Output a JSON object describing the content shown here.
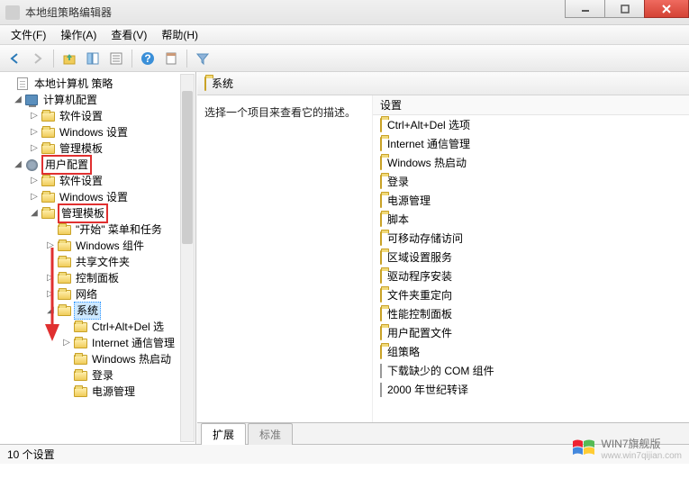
{
  "title": "本地组策略编辑器",
  "menu": {
    "file": "文件(F)",
    "action": "操作(A)",
    "view": "查看(V)",
    "help": "帮助(H)"
  },
  "tree": {
    "root": "本地计算机 策略",
    "computer_config": "计算机配置",
    "cc_software": "软件设置",
    "cc_windows": "Windows 设置",
    "cc_admin": "管理模板",
    "user_config": "用户配置",
    "uc_software": "软件设置",
    "uc_windows": "Windows 设置",
    "uc_admin": "管理模板",
    "uc_start_taskbar": "\"开始\" 菜单和任务",
    "uc_win_components": "Windows 组件",
    "uc_shared_folders": "共享文件夹",
    "uc_control_panel": "控制面板",
    "uc_network": "网络",
    "uc_system": "系统",
    "sys_ctrlaltdel": "Ctrl+Alt+Del 选",
    "sys_internet": "Internet 通信管理",
    "sys_win_hot": "Windows 热启动",
    "sys_logon": "登录",
    "sys_power": "电源管理"
  },
  "content": {
    "heading": "系统",
    "description": "选择一个项目来查看它的描述。",
    "settings_header": "设置",
    "items": [
      {
        "label": "Ctrl+Alt+Del 选项",
        "type": "folder"
      },
      {
        "label": "Internet 通信管理",
        "type": "folder"
      },
      {
        "label": "Windows 热启动",
        "type": "folder"
      },
      {
        "label": "登录",
        "type": "folder"
      },
      {
        "label": "电源管理",
        "type": "folder"
      },
      {
        "label": "脚本",
        "type": "folder"
      },
      {
        "label": "可移动存储访问",
        "type": "folder"
      },
      {
        "label": "区域设置服务",
        "type": "folder"
      },
      {
        "label": "驱动程序安装",
        "type": "folder"
      },
      {
        "label": "文件夹重定向",
        "type": "folder"
      },
      {
        "label": "性能控制面板",
        "type": "folder"
      },
      {
        "label": "用户配置文件",
        "type": "folder"
      },
      {
        "label": "组策略",
        "type": "folder"
      },
      {
        "label": "下载缺少的 COM 组件",
        "type": "doc"
      },
      {
        "label": "2000 年世纪转译",
        "type": "doc"
      }
    ]
  },
  "tabs": {
    "extended": "扩展",
    "standard": "标准"
  },
  "status": "10 个设置",
  "watermark": {
    "brand": "WIN7旗舰版",
    "url": "www.win7qijian.com"
  }
}
